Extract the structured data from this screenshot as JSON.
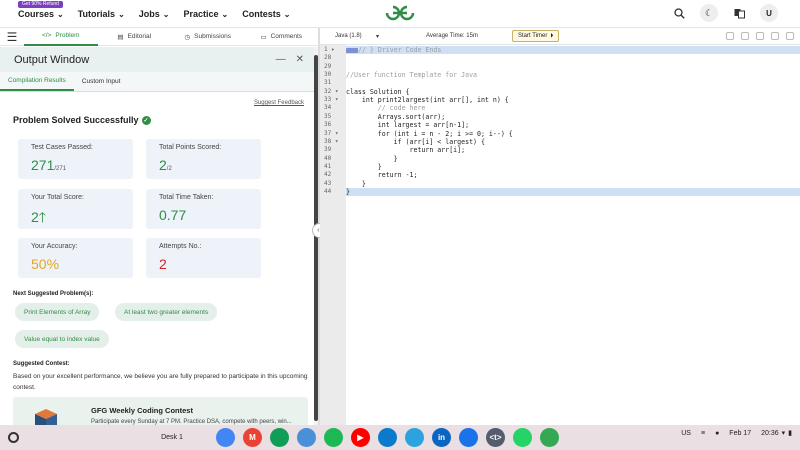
{
  "nav": {
    "promo": "Get 90% Refund",
    "items": [
      "Courses",
      "Tutorials",
      "Jobs",
      "Practice",
      "Contests"
    ],
    "logo_alt": "GfG"
  },
  "left_tabs": {
    "problem": "Problem",
    "editorial": "Editorial",
    "submissions": "Submissions",
    "comments": "Comments"
  },
  "output": {
    "title": "Output Window",
    "tabs": [
      "Compilation Results",
      "Custom Input"
    ],
    "suggest_feedback": "Suggest Feedback",
    "status": "Problem Solved Successfully",
    "stats": {
      "test_cases_label": "Test Cases Passed:",
      "test_cases_value": "271",
      "test_cases_total": "/271",
      "points_label": "Total Points Scored:",
      "points_value": "2",
      "points_total": "/2",
      "score_label": "Your Total Score:",
      "score_value": "2",
      "time_label": "Total Time Taken:",
      "time_value": "0.77",
      "accuracy_label": "Your Accuracy:",
      "accuracy_value": "50%",
      "attempts_label": "Attempts No.:",
      "attempts_value": "2"
    },
    "next_heading": "Next Suggested Problem(s):",
    "next_problems": [
      "Print Elements of Array",
      "At least two greater elements",
      "Value equal to index value"
    ],
    "contest_heading": "Suggested Contest:",
    "contest_text": "Based on your excellent performance, we believe you are fully prepared to participate in this upcoming contest.",
    "contest_title": "GFG Weekly Coding Contest",
    "contest_sub": "Participate every Sunday at 7 PM. Practice DSA, compete with peers, win..."
  },
  "editor": {
    "language": "Java (1.8)",
    "average_time": "Average Time: 15m",
    "timer_label": "Start Timer",
    "lines": [
      {
        "n": "1",
        "fold": "▸",
        "text": "// } Driver Code Ends",
        "cls": "cm",
        "marker": true,
        "hl": true
      },
      {
        "n": "28",
        "text": ""
      },
      {
        "n": "29",
        "text": ""
      },
      {
        "n": "30",
        "text": "//User function Template for Java",
        "cls": "cm"
      },
      {
        "n": "31",
        "text": ""
      },
      {
        "n": "32",
        "fold": "▾",
        "text": "class Solution {"
      },
      {
        "n": "33",
        "fold": "▾",
        "text": "    int print2largest(int arr[], int n) {"
      },
      {
        "n": "34",
        "text": "        // code here",
        "cls": "cm"
      },
      {
        "n": "35",
        "text": "        Arrays.sort(arr);"
      },
      {
        "n": "36",
        "text": "        int largest = arr[n-1];"
      },
      {
        "n": "37",
        "fold": "▾",
        "text": "        for (int i = n - 2; i >= 0; i--) {"
      },
      {
        "n": "38",
        "fold": "▾",
        "text": "            if (arr[i] < largest) {"
      },
      {
        "n": "39",
        "text": "                return arr[i];"
      },
      {
        "n": "40",
        "text": "            }"
      },
      {
        "n": "41",
        "text": "        }"
      },
      {
        "n": "42",
        "text": "        return -1;"
      },
      {
        "n": "43",
        "text": "    }"
      },
      {
        "n": "44",
        "text": "}",
        "hl": true
      }
    ]
  },
  "shelf": {
    "desk": "Desk 1",
    "apps": [
      {
        "name": "chrome-app",
        "label": "",
        "color": "#4285f4"
      },
      {
        "name": "gmail-app",
        "label": "M",
        "color": "#ea4335"
      },
      {
        "name": "sheets-app",
        "label": "",
        "color": "#0f9d58"
      },
      {
        "name": "explorer-app",
        "label": "",
        "color": "#4a90d9"
      },
      {
        "name": "spotify-app",
        "label": "",
        "color": "#1db954"
      },
      {
        "name": "youtube-app",
        "label": "▶",
        "color": "#ff0000"
      },
      {
        "name": "vscode-app",
        "label": "",
        "color": "#0a7acc"
      },
      {
        "name": "telegram-app",
        "label": "",
        "color": "#2aa3df"
      },
      {
        "name": "linkedin-app",
        "label": "in",
        "color": "#0a66c2"
      },
      {
        "name": "files-app",
        "label": "",
        "color": "#1a73e8"
      },
      {
        "name": "terminal-app",
        "label": "<t>",
        "color": "#555c6e"
      },
      {
        "name": "whatsapp-app",
        "label": "",
        "color": "#25d366"
      },
      {
        "name": "drive-app",
        "label": "",
        "color": "#34a853"
      }
    ],
    "lang": "US",
    "date": "Feb 17",
    "time": "20:36"
  }
}
